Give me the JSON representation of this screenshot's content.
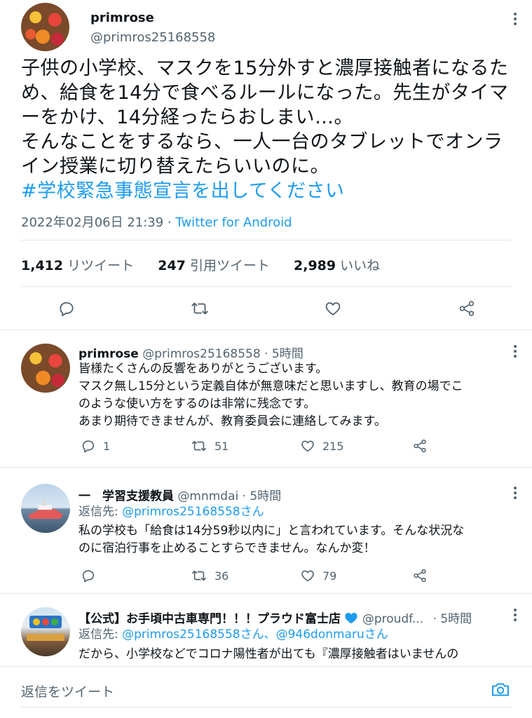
{
  "main_tweet": {
    "name": "primrose",
    "handle": "@primros25168558",
    "text_lines": [
      "子供の小学校、マスクを15分外すと濃厚接触者になるた",
      "め、給食を14分で食べるルールになった。先生がタイマ",
      "ーをかけ、14分経ったらおしまい…。",
      "そんなことをするなら、一人一台のタブレットでオンラ",
      "イン授業に切り替えたらいいのに。"
    ],
    "hashtag": "#学校緊急事態宣言を出してください",
    "timestamp": "2022年02月06日 21:39",
    "separator": "·",
    "source": "Twitter for Android",
    "retweets": "1,412",
    "retweets_label": "リツイート",
    "quotes": "247",
    "quotes_label": "引用ツイート",
    "likes": "2,989",
    "likes_label": "いいね"
  },
  "replies": [
    {
      "name": "primrose",
      "handle": "@primros25168558",
      "time": "· 5時間",
      "text_lines": [
        "皆様たくさんの反響をありがとうございます。",
        "マスク無し15分という定義自体が無意味だと思いますし、教育の場でこ",
        "のような使い方をするのは非常に残念です。",
        "あまり期待できませんが、教育委員会に連絡してみます。"
      ],
      "replies": "1",
      "retweets": "51",
      "likes": "215"
    },
    {
      "name": "一　学習支援教員",
      "handle": "@mnmdai",
      "time": "· 5時間",
      "reply_to_label": "返信先:",
      "reply_to": "@primros25168558さん",
      "text_lines": [
        "私の学校も「給食は14分59秒以内に」と言われています。そんな状況な",
        "のに宿泊行事を止めることすらできません。なんか変！"
      ],
      "replies": "",
      "retweets": "36",
      "likes": "79"
    },
    {
      "name": "【公式】お手頃中古車専門！！！プラウド富士店",
      "handle": "@proudf...",
      "time": "· 5時間",
      "reply_to_label": "返信先:",
      "reply_to": "@primros25168558さん、@946donmaruさん",
      "text_lines": [
        "だから、小学校などでコロナ陽性者が出ても『濃厚接触者はいませんの"
      ]
    }
  ],
  "compose": {
    "placeholder": "返信をツイート"
  },
  "colors": {
    "accent": "#1d9bf0",
    "muted": "#536471",
    "text": "#0f1419",
    "divider": "#e1e8ed"
  }
}
